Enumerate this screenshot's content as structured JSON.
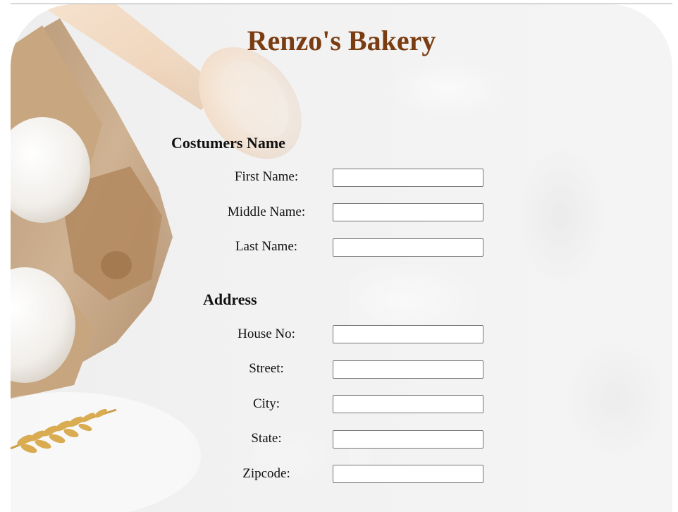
{
  "page": {
    "title": "Renzo's Bakery"
  },
  "customer_section": {
    "heading": "Costumers Name",
    "fields": [
      {
        "label": "First Name:",
        "value": ""
      },
      {
        "label": "Middle Name:",
        "value": ""
      },
      {
        "label": "Last Name:",
        "value": ""
      }
    ]
  },
  "address_section": {
    "heading": "Address",
    "fields": [
      {
        "label": "House No:",
        "value": ""
      },
      {
        "label": "Street:",
        "value": ""
      },
      {
        "label": "City:",
        "value": ""
      },
      {
        "label": "State:",
        "value": ""
      },
      {
        "label": "Zipcode:",
        "value": ""
      }
    ]
  },
  "colors": {
    "title": "#7a3d12",
    "background": "#f2f2f2",
    "input_border": "#767676"
  },
  "decorations": {
    "background_image": "bakery-eggs-spoon-wheat"
  }
}
